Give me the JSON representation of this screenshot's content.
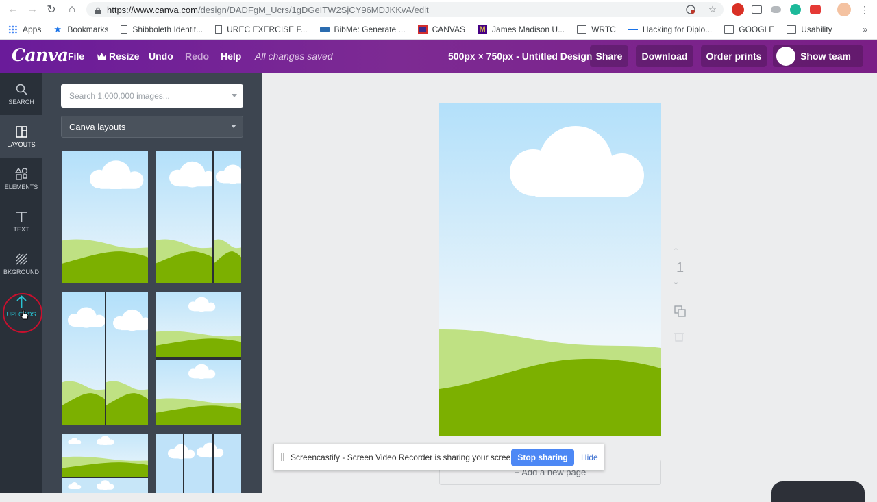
{
  "browser": {
    "url_host": "https://www.canva.com",
    "url_path": "/design/DADFgM_Ucrs/1gDGeITW2SjCY96MDJKKvA/edit",
    "bookmarks": [
      "Apps",
      "Bookmarks",
      "Shibboleth Identit...",
      "UREC EXERCISE F...",
      "BibMe: Generate ...",
      "CANVAS",
      "James Madison U...",
      "WRTC",
      "Hacking for Diplo...",
      "GOOGLE",
      "Usability"
    ],
    "more": "»"
  },
  "header": {
    "logo": "Canva",
    "menu": [
      "File",
      "Resize",
      "Undo",
      "Redo",
      "Help"
    ],
    "save_status": "All changes saved",
    "design_title": "500px × 750px - Untitled Design",
    "buttons": [
      "Share",
      "Download",
      "Order prints"
    ],
    "show_team": "Show team"
  },
  "rail": {
    "items": [
      "SEARCH",
      "LAYOUTS",
      "ELEMENTS",
      "TEXT",
      "BKGROUND",
      "UPLOADS"
    ]
  },
  "panel": {
    "search_placeholder": "Search 1,000,000 images...",
    "layout_filter": "Canva layouts"
  },
  "canvas": {
    "page_number": "1",
    "add_page": "+ Add a new page"
  },
  "screencastify": {
    "message": "Screencastify - Screen Video Recorder is sharing your screen.",
    "stop": "Stop sharing",
    "hide": "Hide"
  },
  "colors": {
    "brand_purple": "#6a1b9a",
    "rail_bg": "#293039",
    "panel_bg": "#3d4550",
    "sky_top": "#b3e0fa",
    "hill_light": "#bfe183",
    "hill_dark": "#7cb000",
    "uploads_accent": "#29c4d4"
  }
}
